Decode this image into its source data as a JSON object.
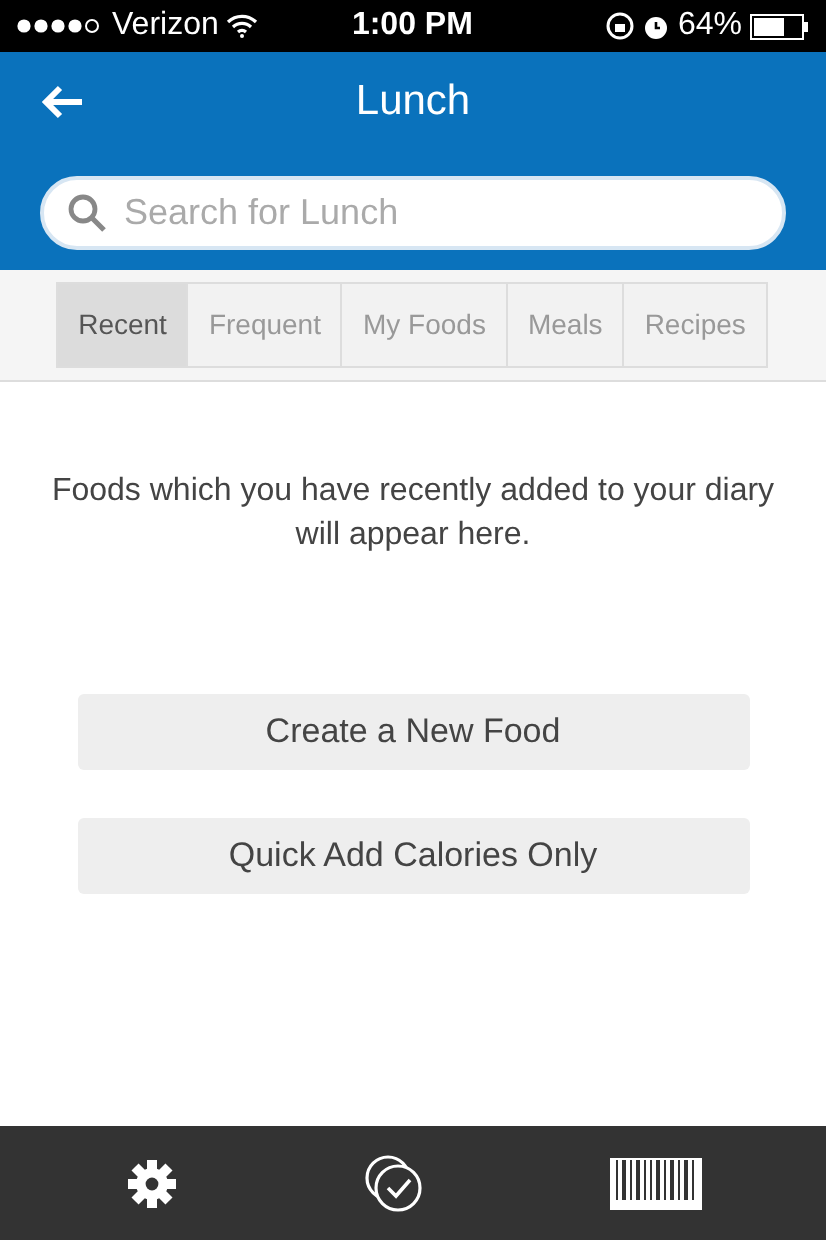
{
  "status_bar": {
    "carrier": "Verizon",
    "time": "1:00 PM",
    "battery": "64%"
  },
  "header": {
    "title": "Lunch"
  },
  "search": {
    "placeholder": "Search for Lunch"
  },
  "tabs": [
    {
      "label": "Recent",
      "selected": true
    },
    {
      "label": "Frequent",
      "selected": false
    },
    {
      "label": "My Foods",
      "selected": false
    },
    {
      "label": "Meals",
      "selected": false
    },
    {
      "label": "Recipes",
      "selected": false
    }
  ],
  "message": "Foods which you have recently added to your diary will appear here.",
  "buttons": [
    "Create a New Food",
    "Quick Add Calories Only"
  ]
}
